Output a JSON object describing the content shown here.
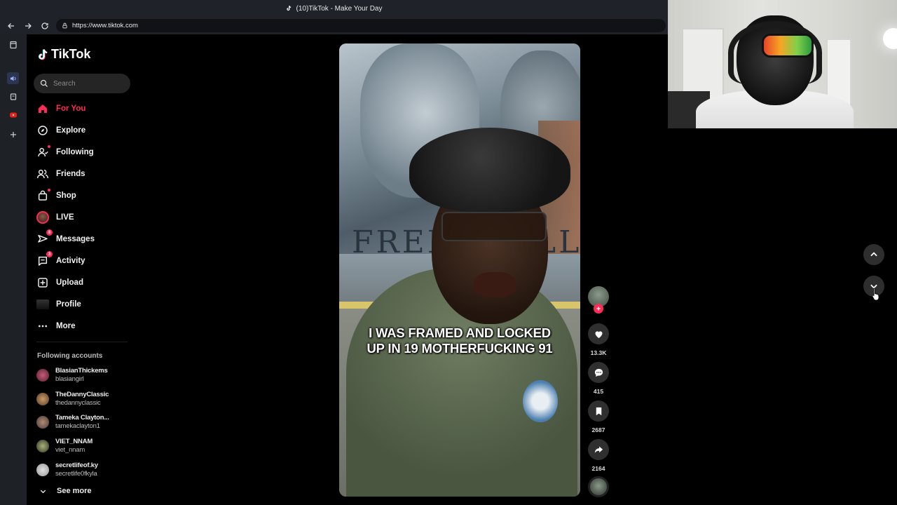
{
  "browser": {
    "window_title": "(10)TikTok - Make Your Day",
    "url": "https://www.tiktok.com"
  },
  "sidebar": {
    "logo_text": "TikTok",
    "search_placeholder": "Search",
    "nav": [
      {
        "label": "For You",
        "icon": "home-icon",
        "active": true
      },
      {
        "label": "Explore",
        "icon": "compass-icon"
      },
      {
        "label": "Following",
        "icon": "following-icon"
      },
      {
        "label": "Friends",
        "icon": "friends-icon"
      },
      {
        "label": "Shop",
        "icon": "shop-icon"
      },
      {
        "label": "LIVE",
        "icon": "live-avatar"
      },
      {
        "label": "Messages",
        "icon": "messages-icon",
        "badge": "8"
      },
      {
        "label": "Activity",
        "icon": "activity-icon",
        "badge": "3"
      },
      {
        "label": "Upload",
        "icon": "upload-icon"
      },
      {
        "label": "Profile",
        "icon": "profile-avatar"
      },
      {
        "label": "More",
        "icon": "more-icon"
      }
    ],
    "following_title": "Following accounts",
    "accounts": [
      {
        "display": "BlasianThickems",
        "handle": "blasiangirl"
      },
      {
        "display": "TheDannyClassic",
        "handle": "thedannyclassic"
      },
      {
        "display": "Tameka Clayton...",
        "handle": "tamekaclayton1"
      },
      {
        "display": "VIET_NNAM",
        "handle": "viet_nnam"
      },
      {
        "display": "secretlifeof.ky",
        "handle": "secretlife0fkyla"
      }
    ],
    "see_more": "See more"
  },
  "video": {
    "mural_text": "FREE",
    "mural_text_right": "LL",
    "caption_line1": "I WAS FRAMED AND LOCKED",
    "caption_line2": "UP IN 19 MOTHERFUCKING 91",
    "likes": "13.3K",
    "comments": "415",
    "saves": "2687",
    "shares": "2164"
  },
  "colors": {
    "accent": "#fe2c55",
    "sidebar_bg": "#000000",
    "chrome_bg": "#1f2329"
  }
}
